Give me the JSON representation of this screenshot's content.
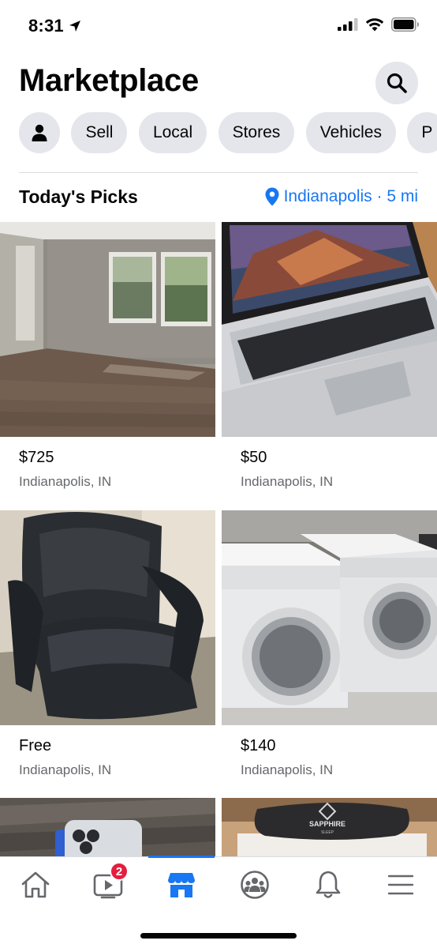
{
  "status": {
    "time": "8:31"
  },
  "header": {
    "title": "Marketplace"
  },
  "chips": [
    {
      "label": "Sell"
    },
    {
      "label": "Local"
    },
    {
      "label": "Stores"
    },
    {
      "label": "Vehicles"
    },
    {
      "label": "P"
    }
  ],
  "section": {
    "title": "Today's Picks",
    "location": "Indianapolis · 5 mi"
  },
  "listings": [
    {
      "price": "$725",
      "location": "Indianapolis, IN",
      "image": "empty-room-photo"
    },
    {
      "price": "$50",
      "location": "Indianapolis, IN",
      "image": "laptop-photo"
    },
    {
      "price": "Free",
      "location": "Indianapolis, IN",
      "image": "leather-chair-photo"
    },
    {
      "price": "$140",
      "location": "Indianapolis, IN",
      "image": "washer-dryer-photo"
    },
    {
      "price": "",
      "location": "",
      "image": "phone-photo"
    },
    {
      "price": "",
      "location": "",
      "image": "mattress-photo"
    }
  ],
  "mattress_brand": {
    "name": "SAPPHIRE",
    "sub": "SLEEP"
  },
  "tabs": [
    {
      "name": "home",
      "icon": "home-icon"
    },
    {
      "name": "watch",
      "icon": "video-icon",
      "badge": "2"
    },
    {
      "name": "marketplace",
      "icon": "shop-icon",
      "active": true
    },
    {
      "name": "groups",
      "icon": "groups-icon"
    },
    {
      "name": "notifications",
      "icon": "bell-icon"
    },
    {
      "name": "menu",
      "icon": "menu-icon"
    }
  ],
  "colors": {
    "accent": "#1877f2",
    "chip_bg": "#e4e6eb",
    "badge": "#e41e3f",
    "secondary_text": "#65676b"
  }
}
